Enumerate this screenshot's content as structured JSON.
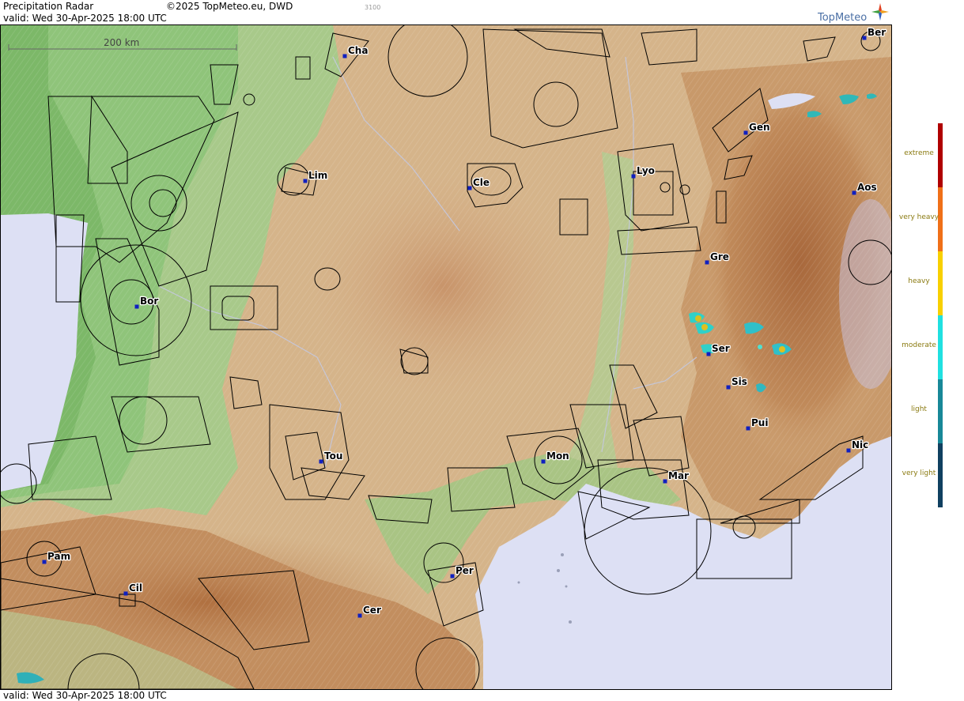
{
  "header": {
    "title": "Precipitation Radar",
    "copyright": "©2025 TopMeteo.eu, DWD",
    "valid": "valid:  Wed  30-Apr-2025 18:00 UTC",
    "small_code": "3100"
  },
  "brand": {
    "logo_text": "TopMeteo"
  },
  "footer": {
    "valid": "valid:  Wed  30-Apr-2025 18:00 UTC"
  },
  "map": {
    "scale_label": "200 km",
    "cities": [
      {
        "name": "Cha"
      },
      {
        "name": "Ber"
      },
      {
        "name": "Gen"
      },
      {
        "name": "Lim"
      },
      {
        "name": "Cle"
      },
      {
        "name": "Lyo"
      },
      {
        "name": "Aos"
      },
      {
        "name": "Gre"
      },
      {
        "name": "Bor"
      },
      {
        "name": "Ser"
      },
      {
        "name": "Sis"
      },
      {
        "name": "Pui"
      },
      {
        "name": "Tou"
      },
      {
        "name": "Mon"
      },
      {
        "name": "Nic"
      },
      {
        "name": "Mar"
      },
      {
        "name": "Pam"
      },
      {
        "name": "Per"
      },
      {
        "name": "Cil"
      },
      {
        "name": "Cer"
      }
    ],
    "colors": {
      "sea": "#dde0f4",
      "lowland": "#8fc47a",
      "upland": "#d9b890",
      "mountain": "#b87a4a",
      "city_marker": "#1020c0"
    }
  },
  "legend": {
    "items": [
      {
        "label": "extreme",
        "color": "#b00000"
      },
      {
        "label": "very heavy",
        "color": "#f07018"
      },
      {
        "label": "heavy",
        "color": "#f8d000"
      },
      {
        "label": "moderate",
        "color": "#20e0e0"
      },
      {
        "label": "light",
        "color": "#188898"
      },
      {
        "label": "very light",
        "color": "#104060"
      }
    ]
  }
}
